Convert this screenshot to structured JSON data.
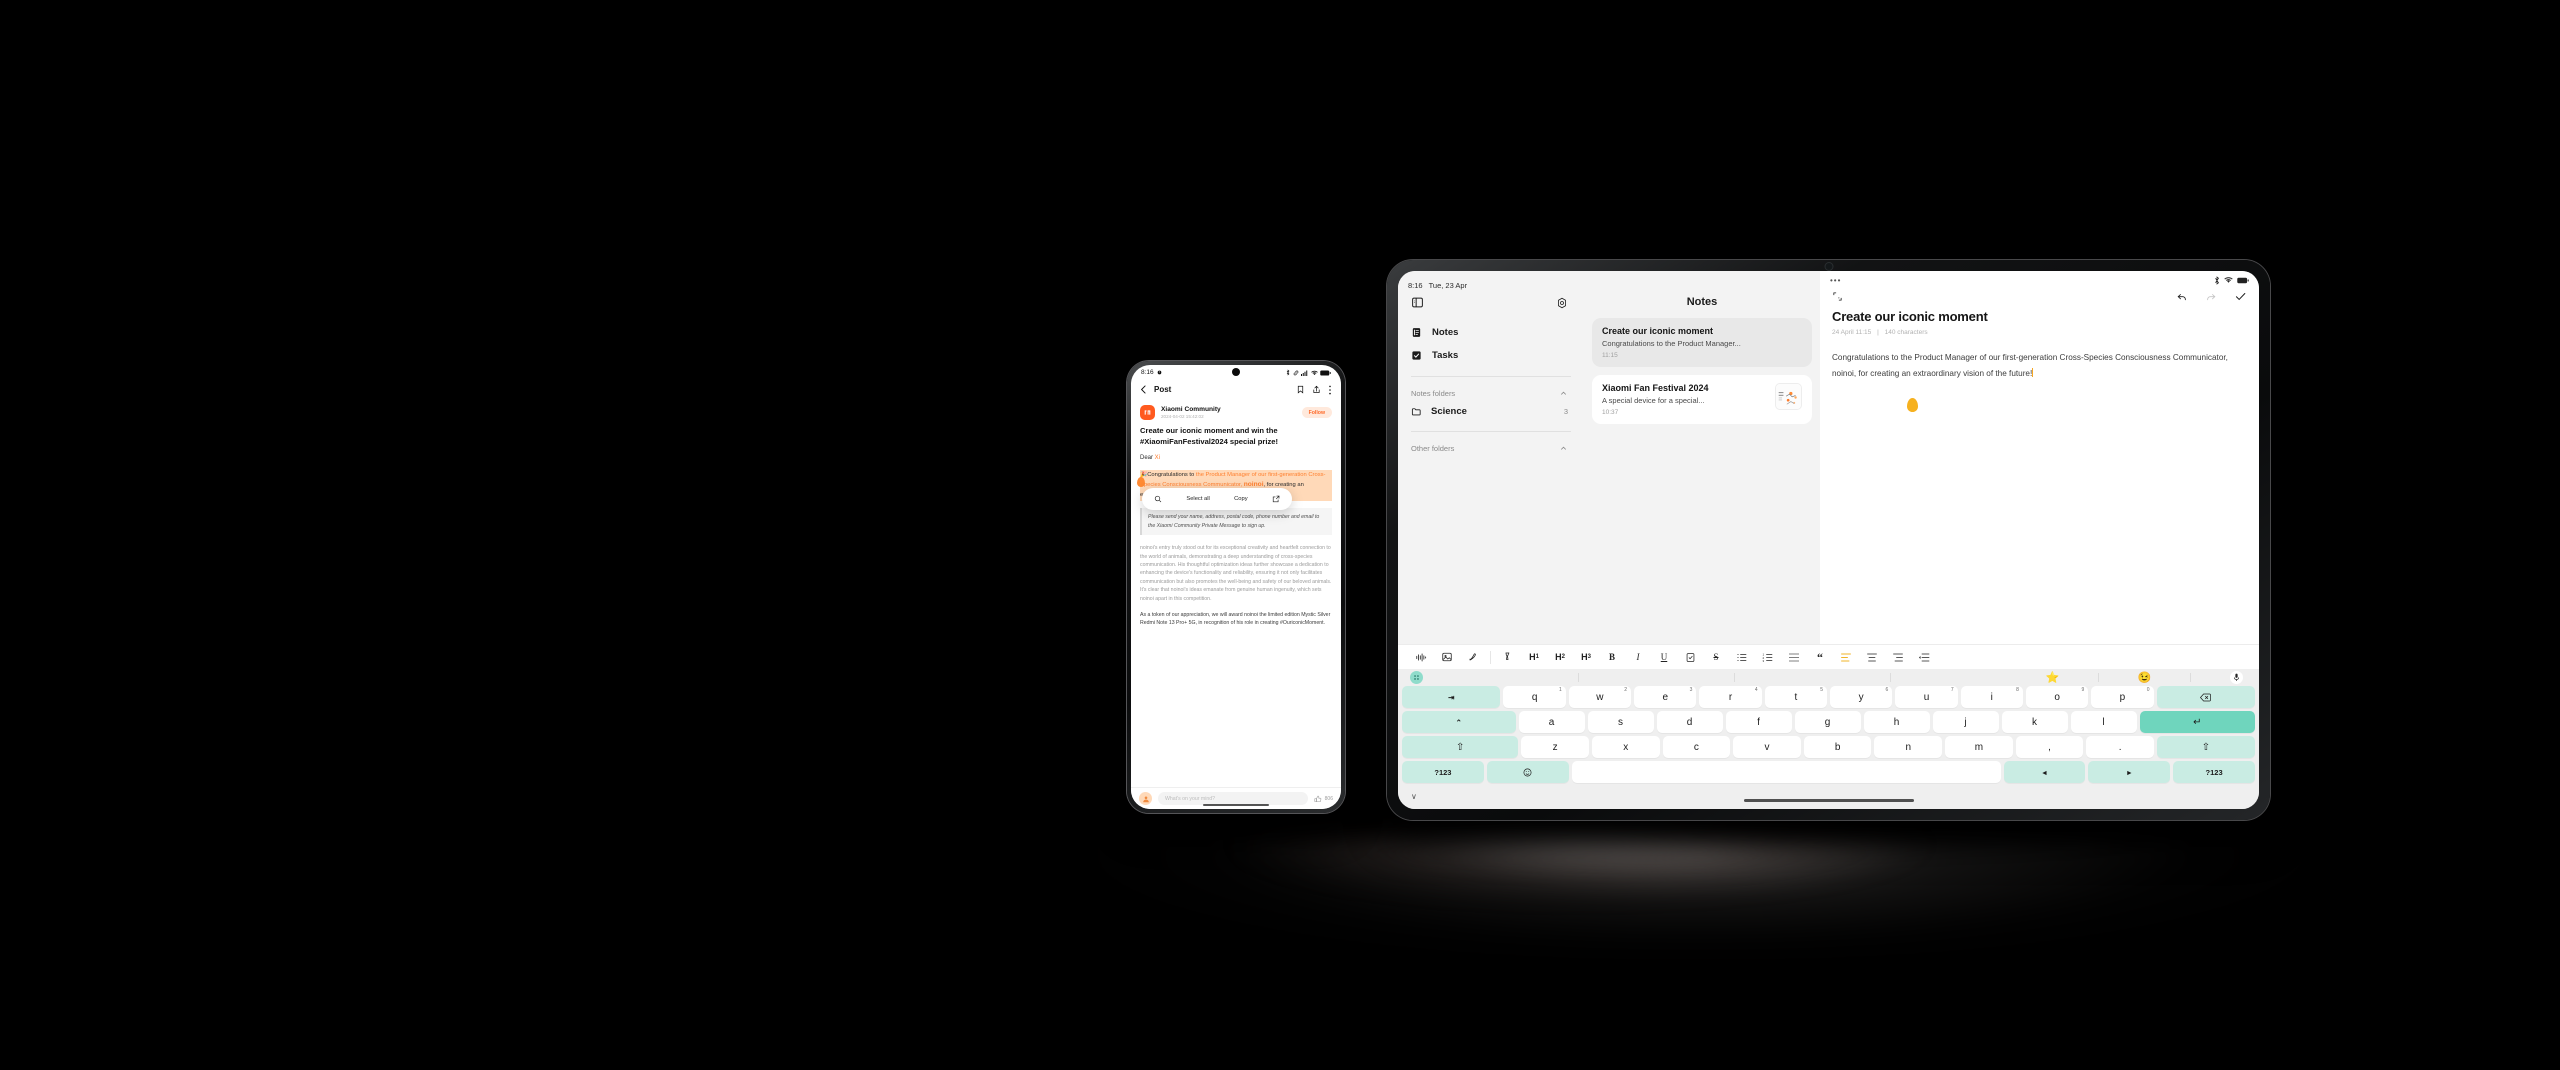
{
  "scene": {
    "background_color": "#000000",
    "accent_orange": "#ff7f2e",
    "accent_teal": "#6fd5bd",
    "accent_yellow": "#f6b11f"
  },
  "tablet": {
    "status_bar": {
      "time": "8:16",
      "date": "Tue, 23 Apr",
      "overflow": "•••"
    },
    "sidebar": {
      "panel_toggle": "panel-toggle-icon",
      "settings": "gear-icon",
      "nav": [
        {
          "label": "Notes",
          "icon": "notes-icon"
        },
        {
          "label": "Tasks",
          "icon": "checkbox-icon"
        }
      ],
      "groups": [
        {
          "label": "Notes folders",
          "collapsed": false,
          "folders": [
            {
              "label": "Science",
              "count": "3"
            }
          ]
        },
        {
          "label": "Other folders",
          "collapsed": false,
          "folders": []
        }
      ]
    },
    "note_list": {
      "title": "Notes",
      "items": [
        {
          "title": "Create our iconic moment",
          "preview": "Congratulations to the Product Manager...",
          "time": "11:15",
          "selected": true,
          "has_thumb": false
        },
        {
          "title": "Xiaomi Fan Festival 2024",
          "preview": "A special device for a special...",
          "time": "10:37",
          "selected": false,
          "has_thumb": true
        }
      ]
    },
    "editor": {
      "expand": "expand-icon",
      "undo": "undo-icon",
      "redo": "redo-icon",
      "done": "check-icon",
      "note_title": "Create our iconic moment",
      "meta_date": "24 April 11:15",
      "meta_divider": "|",
      "meta_chars": "140 characters",
      "body": "Congratulations to the Product Manager of our first-generation Cross-Species Consciousness Communicator, noinoi, for creating an extraordinary vision of the future!"
    },
    "toolbar": [
      {
        "name": "audio-waveform-icon",
        "label": ""
      },
      {
        "name": "image-icon",
        "label": ""
      },
      {
        "name": "scribble-icon",
        "label": ""
      },
      {
        "name": "divider",
        "label": ""
      },
      {
        "name": "highlighter-pen-icon",
        "label": ""
      },
      {
        "name": "heading-1-icon",
        "label": "H1"
      },
      {
        "name": "heading-2-icon",
        "label": "H2"
      },
      {
        "name": "heading-3-icon",
        "label": "H3"
      },
      {
        "name": "bold-icon",
        "label": "B"
      },
      {
        "name": "italic-icon",
        "label": "I"
      },
      {
        "name": "underline-icon",
        "label": "U"
      },
      {
        "name": "checklist-icon",
        "label": ""
      },
      {
        "name": "strikethrough-icon",
        "label": "S"
      },
      {
        "name": "bullet-list-icon",
        "label": ""
      },
      {
        "name": "numbered-list-icon",
        "label": ""
      },
      {
        "name": "dashed-list-icon",
        "label": ""
      },
      {
        "name": "quote-icon",
        "label": "“"
      },
      {
        "name": "align-left-icon",
        "label": "",
        "active": true
      },
      {
        "name": "align-center-icon",
        "label": ""
      },
      {
        "name": "align-right-icon",
        "label": ""
      },
      {
        "name": "indent-icon",
        "label": ""
      }
    ],
    "keyboard": {
      "suggestion_bar": {
        "grid_icon": "keyboard-grid-icon",
        "star_icon": "star-icon",
        "emoji_icon": "emoji-smiley-icon",
        "mic_icon": "microphone-icon"
      },
      "row1": [
        {
          "key": "→|",
          "type": "func",
          "name": "tab-key"
        },
        {
          "key": "q",
          "num": "1"
        },
        {
          "key": "w",
          "num": "2"
        },
        {
          "key": "e",
          "num": "3"
        },
        {
          "key": "r",
          "num": "4"
        },
        {
          "key": "t",
          "num": "5"
        },
        {
          "key": "y",
          "num": "6"
        },
        {
          "key": "u",
          "num": "7"
        },
        {
          "key": "i",
          "num": "8"
        },
        {
          "key": "o",
          "num": "9"
        },
        {
          "key": "p",
          "num": "0"
        },
        {
          "key": "⌫",
          "type": "func",
          "name": "backspace-key"
        }
      ],
      "row2": [
        {
          "key": "⌃",
          "type": "func",
          "name": "caps-key"
        },
        {
          "key": "a"
        },
        {
          "key": "s"
        },
        {
          "key": "d"
        },
        {
          "key": "f"
        },
        {
          "key": "g"
        },
        {
          "key": "h"
        },
        {
          "key": "j"
        },
        {
          "key": "k"
        },
        {
          "key": "l"
        },
        {
          "key": "↵",
          "type": "enter",
          "name": "enter-key"
        }
      ],
      "row3": [
        {
          "key": "⇧",
          "type": "func",
          "name": "shift-left-key"
        },
        {
          "key": "z"
        },
        {
          "key": "x"
        },
        {
          "key": "c"
        },
        {
          "key": "v"
        },
        {
          "key": "b"
        },
        {
          "key": "n"
        },
        {
          "key": "m"
        },
        {
          "key": ","
        },
        {
          "key": "."
        },
        {
          "key": "⇧",
          "type": "func",
          "name": "shift-right-key"
        }
      ],
      "row4": [
        {
          "key": "?123",
          "type": "func",
          "name": "symbols-left-key"
        },
        {
          "key": "☺",
          "type": "func",
          "name": "emoji-key"
        },
        {
          "key": "",
          "type": "space",
          "name": "space-key"
        },
        {
          "key": "◂",
          "type": "func",
          "name": "cursor-left-key"
        },
        {
          "key": "▸",
          "type": "func",
          "name": "cursor-right-key"
        },
        {
          "key": "?123",
          "type": "func",
          "name": "symbols-right-key"
        }
      ],
      "hide_keyboard": "∨"
    }
  },
  "phone": {
    "status_bar": {
      "time": "8:16"
    },
    "app_bar": {
      "back": "back-chevron-icon",
      "title": "Post",
      "bookmark": "bookmark-icon",
      "share": "share-icon",
      "more": "more-vertical-icon"
    },
    "post": {
      "author": "Xiaomi Community",
      "timestamp": "2024-04-02 15:42:02",
      "follow_label": "Follow",
      "title": "Create our iconic moment and win the #XiaomiFanFestival2024 special prize!",
      "salutation_prefix": "Dear ",
      "salutation_name": "Xi",
      "highlight_emoji": "🎉",
      "highlight_p1": "Congratulations to ",
      "highlight_p2": "the Product Manager of our first-generation Cross-Species Consciousness Communicator, ",
      "highlight_name": "noinoi",
      "highlight_p3": ", for creating an extraordinary vision of the future!",
      "quote": "Please send your name, address, postal code, phone number and email to the Xiaomi Community Private Message to sign up.",
      "para1": "noinoi's entry truly stood out for its exceptional creativity and heartfelt connection to the world of animals, demonstrating a deep understanding of cross-species communication. His thoughtful optimization ideas further showcase a dedication to enhancing the device's functionality and reliability, ensuring it not only facilitates communication but also promotes the well-being and safety of our beloved animals.",
      "para2": "It's clear that noinoi's ideas emanate from genuine human ingenuity, which sets noinoi apart in this competition.",
      "para3": "As a token of our appreciation, we will award noinoi the limited edition Mystic Silver Redmi Note 13 Pro+ 5G, in recognition of his role in creating #OuriconicMoment."
    },
    "popup": {
      "search_icon": "search-icon",
      "select_all": "Select all",
      "copy": "Copy",
      "share_out_icon": "share-external-icon"
    },
    "comment_bar": {
      "avatar": "user-avatar",
      "placeholder": "What's on your mind?",
      "like_icon": "thumbs-up-icon",
      "like_count": "806"
    }
  }
}
